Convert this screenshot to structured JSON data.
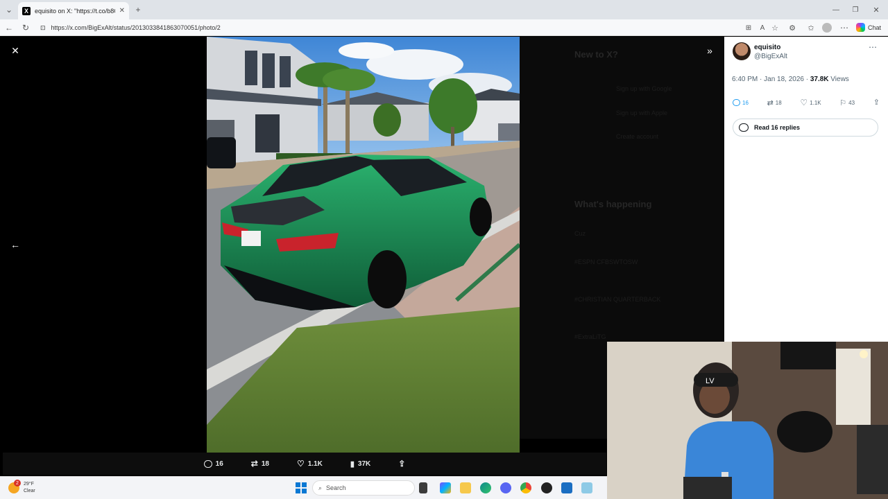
{
  "browser": {
    "tab_title": "equisito on X: \"https://t.co/b8Cc8t",
    "url": "https://x.com/BigExAlt/status/2013033841863070051/photo/2",
    "chat_label": "Chat"
  },
  "post": {
    "display_name": "equisito",
    "handle": "@BigExAlt",
    "time": "6:40 PM · Jan 18, 2026 · ",
    "views_count": "37.8K",
    "views_label": " Views",
    "replies": "16",
    "reposts": "18",
    "likes": "1.1K",
    "bookmarks": "43",
    "read_replies": "Read 16 replies"
  },
  "media_actions": {
    "replies": "16",
    "reposts": "18",
    "likes": "1.1K",
    "views": "37K"
  },
  "background_sidebar": {
    "new_to_x": "New to X?",
    "signup_google": "Sign up with Google",
    "signup_apple": "Sign up with Apple",
    "create_account": "Create account",
    "whats_happening": "What's happening",
    "trend_1": "Cuz",
    "trend_2": "#ESPN CFBSWTOSW",
    "trend_3": "#CHRISTIAN QUARTERBACK",
    "trend_4": "#ExtraLiTG"
  },
  "taskbar": {
    "weather_temp": "29°F",
    "weather_desc": "Clear",
    "weather_badge": "2",
    "search_placeholder": "Search"
  },
  "colors": {
    "accent_blue": "#1d9bf0",
    "car_green": "#1c8a55"
  }
}
